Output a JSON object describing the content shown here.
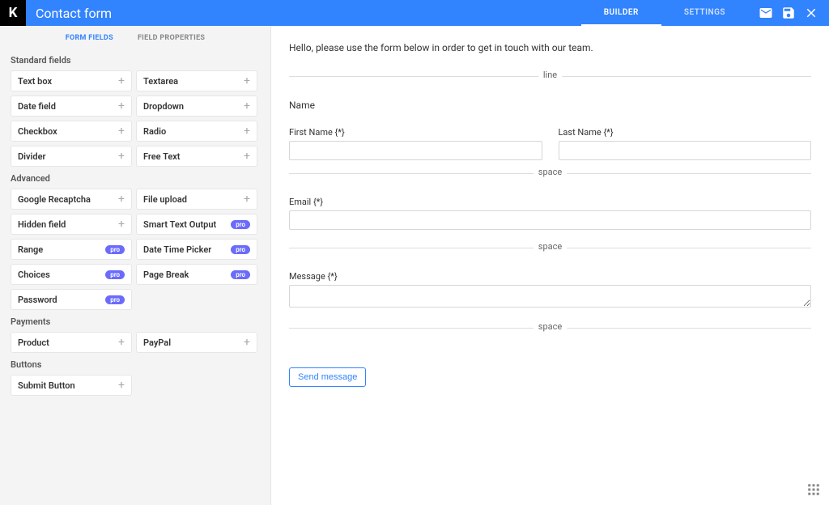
{
  "header": {
    "logo_letter": "K",
    "title": "Contact form",
    "tabs": [
      {
        "label": "BUILDER",
        "active": true
      },
      {
        "label": "SETTINGS",
        "active": false
      }
    ]
  },
  "sidebar": {
    "sub_tabs": [
      {
        "label": "FORM FIELDS",
        "active": true
      },
      {
        "label": "FIELD PROPERTIES",
        "active": false
      }
    ],
    "groups": [
      {
        "label": "Standard fields",
        "items": [
          {
            "label": "Text box",
            "badge": "plus"
          },
          {
            "label": "Textarea",
            "badge": "plus"
          },
          {
            "label": "Date field",
            "badge": "plus"
          },
          {
            "label": "Dropdown",
            "badge": "plus"
          },
          {
            "label": "Checkbox",
            "badge": "plus"
          },
          {
            "label": "Radio",
            "badge": "plus"
          },
          {
            "label": "Divider",
            "badge": "plus"
          },
          {
            "label": "Free Text",
            "badge": "plus"
          }
        ]
      },
      {
        "label": "Advanced",
        "items": [
          {
            "label": "Google Recaptcha",
            "badge": "plus"
          },
          {
            "label": "File upload",
            "badge": "plus"
          },
          {
            "label": "Hidden field",
            "badge": "plus"
          },
          {
            "label": "Smart Text Output",
            "badge": "pro"
          },
          {
            "label": "Range",
            "badge": "pro"
          },
          {
            "label": "Date Time Picker",
            "badge": "pro"
          },
          {
            "label": "Choices",
            "badge": "pro"
          },
          {
            "label": "Page Break",
            "badge": "pro"
          },
          {
            "label": "Password",
            "badge": "pro"
          }
        ]
      },
      {
        "label": "Payments",
        "items": [
          {
            "label": "Product",
            "badge": "plus"
          },
          {
            "label": "PayPal",
            "badge": "plus"
          }
        ]
      },
      {
        "label": "Buttons",
        "items": [
          {
            "label": "Submit Button",
            "badge": "plus"
          }
        ]
      }
    ],
    "pro_text": "pro"
  },
  "canvas": {
    "intro": "Hello, please use the form below in order to get in touch with our team.",
    "separators": {
      "line": "line",
      "space": "space"
    },
    "name_section_label": "Name",
    "first_name_label": "First Name {*}",
    "last_name_label": "Last Name {*}",
    "email_label": "Email {*}",
    "message_label": "Message {*}",
    "submit_label": "Send message"
  }
}
